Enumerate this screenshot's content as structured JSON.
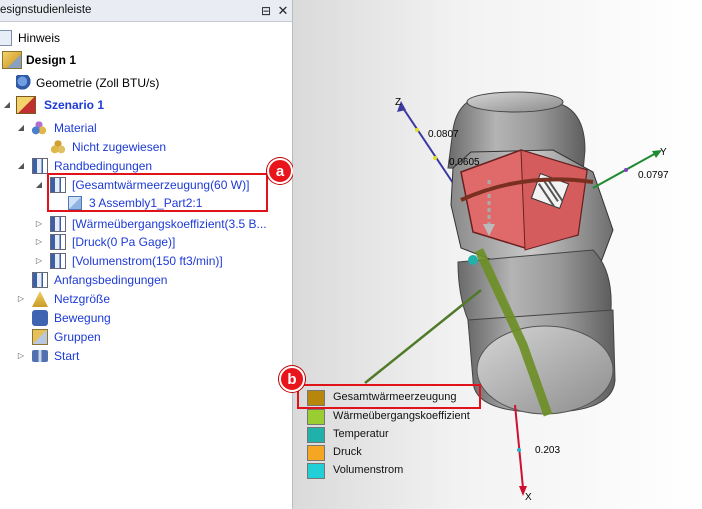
{
  "panel": {
    "title": "esignstudienleiste",
    "pin_glyph": "⊟",
    "close_glyph": "✕"
  },
  "tree": {
    "hint": "Hinweis",
    "design": "Design 1",
    "geometry": "Geometrie (Zoll BTU/s)",
    "scenario": "Szenario 1",
    "material": "Material",
    "not_assigned": "Nicht zugewiesen",
    "boundary_conditions": "Randbedingungen",
    "bc_total_heat": "[Gesamtwärmeerzeugung(60 W)]",
    "bc_total_heat_child": "3 Assembly1_Part2:1",
    "bc_heat_transfer": "[Wärmeübergangskoeffizient(3.5 B...",
    "bc_pressure": "[Druck(0 Pa Gage)]",
    "bc_volume_flow": "[Volumenstrom(150 ft3/min)]",
    "initial_conditions": "Anfangsbedingungen",
    "mesh_size": "Netzgröße",
    "motion": "Bewegung",
    "groups": "Gruppen",
    "start": "Start"
  },
  "icons": [
    "hint-icon",
    "design-icon",
    "geometry-icon",
    "scenario-icon",
    "material-icon",
    "boundary-condition-icon",
    "part-cube-icon",
    "mesh-icon",
    "motion-icon",
    "groups-icon",
    "start-icon"
  ],
  "callouts": {
    "a": "a",
    "b": "b"
  },
  "axes": {
    "z": "Z",
    "y": "Y",
    "x": "X",
    "z_tick": "0.0807",
    "z_tick2": "0.0605",
    "y_tick": "0.0797",
    "x_tick": "0.203"
  },
  "legend": [
    {
      "label": "Gesamtwärmeerzeugung",
      "color": "#b8860b"
    },
    {
      "label": "Wärmeübergangskoeffizient",
      "color": "#9acd32"
    },
    {
      "label": "Temperatur",
      "color": "#20b2aa"
    },
    {
      "label": "Druck",
      "color": "#f5a623"
    },
    {
      "label": "Volumenstrom",
      "color": "#22cfd6"
    }
  ],
  "colors": {
    "accent_red": "#e0121a",
    "highlight_part": "#e06060",
    "link_blue": "#1d3ad6"
  }
}
